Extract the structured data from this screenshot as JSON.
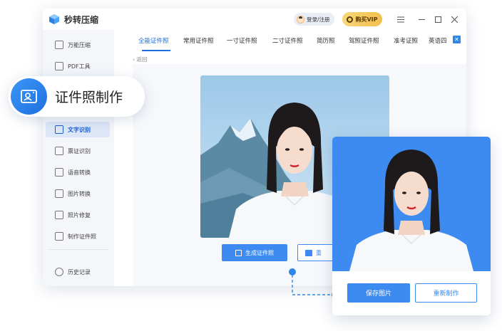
{
  "app": {
    "title": "秒转压缩"
  },
  "header": {
    "login_label": "登录/注册",
    "vip_label": "购买VIP"
  },
  "sidebar": {
    "items": [
      {
        "label": "万能压缩",
        "icon": "archive-icon"
      },
      {
        "label": "PDF工具",
        "icon": "pdf-icon"
      },
      {
        "label": "文字识别",
        "icon": "text-scan-icon",
        "active": true
      },
      {
        "label": "票证识别",
        "icon": "ticket-scan-icon"
      },
      {
        "label": "语音转换",
        "icon": "audio-icon"
      },
      {
        "label": "图片转换",
        "icon": "image-convert-icon"
      },
      {
        "label": "照片修复",
        "icon": "photo-repair-icon"
      },
      {
        "label": "制作证件照",
        "icon": "id-photo-icon"
      }
    ],
    "history_label": "历史记录"
  },
  "tabs": [
    "全能证件照",
    "常用证件照",
    "一寸证件照",
    "二寸证件照",
    "简历照",
    "驾照证件照",
    "准考证照",
    "英语四"
  ],
  "active_tab": 0,
  "back_label": "返回",
  "actions": {
    "generate_label": "生成证件照",
    "secondary_label": "重"
  },
  "feature_pill": {
    "label": "证件照制作",
    "icon": "id-card-icon"
  },
  "result_card": {
    "save_label": "保存图片",
    "redo_label": "重新制作",
    "background_color": "#3d8af0"
  },
  "colors": {
    "accent": "#1a6fe0",
    "primary_button": "#3d8af0",
    "vip_gold": "#f2bf4c"
  }
}
